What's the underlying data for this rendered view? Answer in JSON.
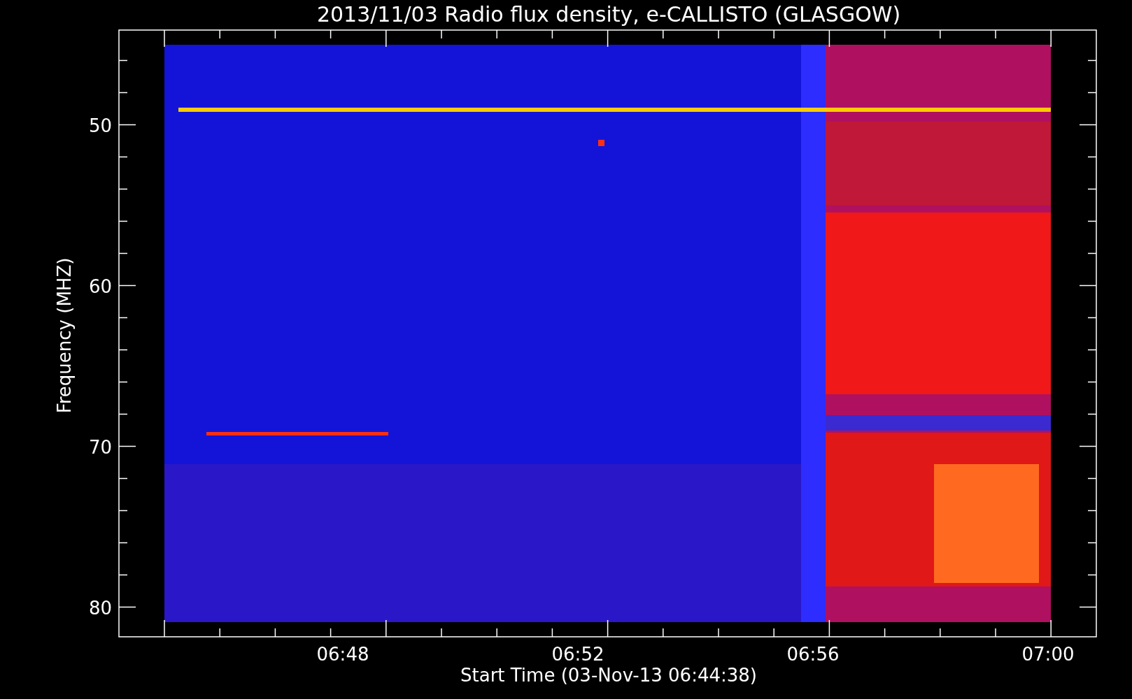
{
  "plot": {
    "title": "2013/11/03  Radio flux density, e-CALLISTO (GLASGOW)",
    "xlabel": "Start Time (03-Nov-13 06:44:38)",
    "ylabel": "Frequency (MHZ)",
    "xticks": [
      "06:48",
      "06:52",
      "06:56",
      "07:00"
    ],
    "yticks": [
      "50",
      "60",
      "70",
      "80"
    ]
  }
}
